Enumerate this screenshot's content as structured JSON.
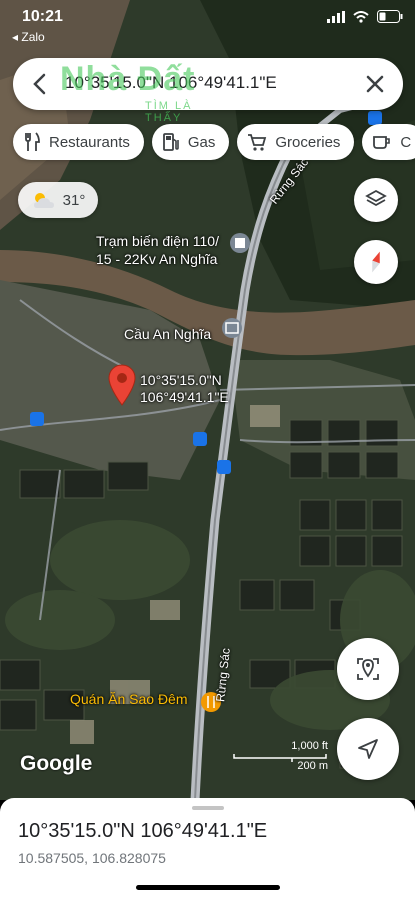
{
  "status_bar": {
    "time": "10:21",
    "back_app": "◂ Zalo"
  },
  "search": {
    "query": "10°35'15.0\"N 106°49'41.1\"E"
  },
  "watermark": {
    "line1": "Nhà Đất",
    "line2": "TÌM LÀ THẤY"
  },
  "chips": [
    {
      "label": "Restaurants",
      "icon": "fork-knife-icon"
    },
    {
      "label": "Gas",
      "icon": "gas-pump-icon"
    },
    {
      "label": "Groceries",
      "icon": "cart-icon"
    },
    {
      "label": "C",
      "icon": "coffee-icon"
    }
  ],
  "weather": {
    "temperature": "31°",
    "icon": "partly-cloudy-icon"
  },
  "map_labels": {
    "road_top": "Rừng Sác",
    "substation": "Trạm biến điện 110/\n15 - 22Kv An Nghĩa",
    "bridge": "Cầu An Nghĩa",
    "pin": "10°35'15.0\"N\n106°49'41.1\"E",
    "road_bottom": "Rừng Sác",
    "restaurant": "Quán Ăn Sao Đêm"
  },
  "map_footer": {
    "brand": "Google",
    "scale_ft": "1,000 ft",
    "scale_m": "200 m"
  },
  "sheet": {
    "coordinates": "10°35'15.0\"N 106°49'41.1\"E",
    "decimal": "10.587505, 106.828075"
  },
  "colors": {
    "pin": "#ea4335",
    "river": "#6b5a48",
    "road": "#9aa0a6",
    "accent_blue": "#1a73e8",
    "restaurant_pin": "#f29900"
  }
}
